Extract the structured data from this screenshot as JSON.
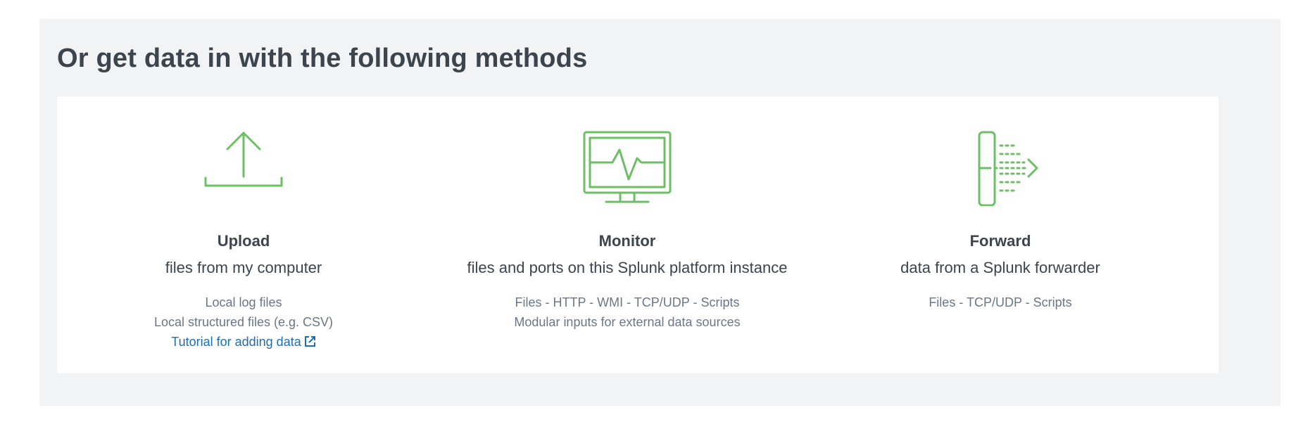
{
  "section": {
    "title": "Or get data in with the following methods"
  },
  "methods": [
    {
      "title": "Upload",
      "subtitle": "files from my computer",
      "lines": [
        "Local log files",
        "Local structured files (e.g. CSV)"
      ],
      "link": "Tutorial for adding data",
      "icon": "upload-icon"
    },
    {
      "title": "Monitor",
      "subtitle": "files and ports on this Splunk platform instance",
      "lines": [
        "Files - HTTP - WMI - TCP/UDP - Scripts",
        "Modular inputs for external data sources"
      ],
      "icon": "monitor-icon"
    },
    {
      "title": "Forward",
      "subtitle": "data from a Splunk forwarder",
      "lines": [
        "Files - TCP/UDP - Scripts"
      ],
      "icon": "forwarder-icon"
    }
  ],
  "colors": {
    "accent_green": "#6cbf64",
    "link_blue": "#1a6fb3",
    "heading": "#3c444d",
    "muted_text": "#6b7785",
    "panel_bg": "#f2f3f4"
  }
}
